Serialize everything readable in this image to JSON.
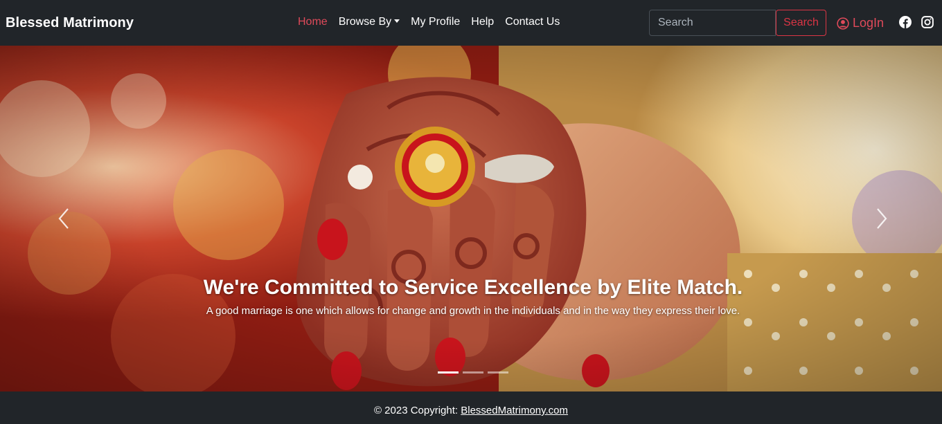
{
  "navbar": {
    "brand": "Blessed Matrimony",
    "links": [
      {
        "label": "Home",
        "active": true
      },
      {
        "label": "Browse By",
        "dropdown": true
      },
      {
        "label": "My Profile"
      },
      {
        "label": "Help"
      },
      {
        "label": "Contact Us"
      }
    ],
    "search": {
      "placeholder": "Search",
      "button_label": "Search"
    },
    "login_label": "LogIn",
    "social_icons": [
      "facebook-icon",
      "instagram-icon"
    ]
  },
  "carousel": {
    "heading": "We're Committed to Service Excellence by Elite Match.",
    "subtext": "A good marriage is one which allows for change and growth in the individuals and in the way they express their love.",
    "slide_count": 3,
    "active_slide": 0,
    "controls": [
      "carousel-prev-icon",
      "carousel-next-icon"
    ]
  },
  "footer": {
    "copyright_prefix": "© 2023 Copyright:",
    "site_link": "BlessedMatrimony.com"
  },
  "colors": {
    "navbar_bg": "#212529",
    "accent_red": "#dc3545",
    "active_link": "#e04a5a"
  }
}
